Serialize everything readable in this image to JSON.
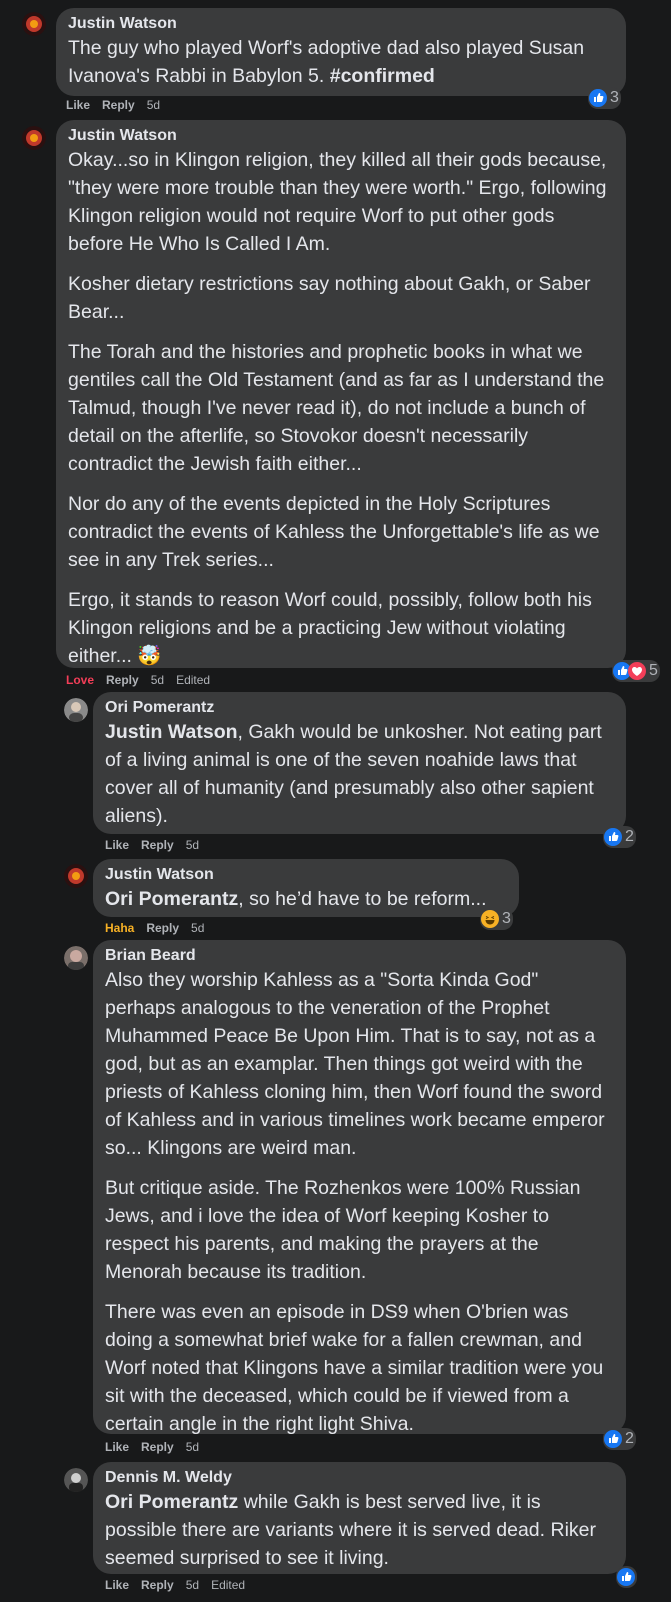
{
  "comments": [
    {
      "author": "Justin Watson",
      "paragraphs": [
        "The guy who played Worf's adoptive dad also played Susan Ivanova's Rabbi in Babylon 5. "
      ],
      "hashtag": "#confirmed",
      "actions": {
        "like": "Like",
        "reply": "Reply",
        "time": "5d"
      },
      "reactions": {
        "count": "3"
      }
    },
    {
      "author": "Justin Watson",
      "paragraphs": [
        "Okay...so in Klingon religion, they killed all their gods because, \"they were more trouble than they were worth.\" Ergo, following Klingon religion would not require Worf to put other gods before He Who Is Called I Am.",
        "Kosher dietary restrictions say nothing about Gakh, or Saber Bear...",
        "The Torah and the histories and prophetic books in what we gentiles call the Old Testament (and as far as I understand the Talmud, though I've never read it), do not include a bunch of detail on the afterlife, so Stovokor doesn't necessarily contradict the Jewish faith either...",
        "Nor do any of the events depicted in the Holy Scriptures contradict the events of Kahless the Unforgettable's life as we see in any Trek series...",
        "Ergo, it stands to reason Worf could, possibly, follow both his Klingon religions and be a practicing Jew without violating either... 🤯"
      ],
      "actions": {
        "like": "Love",
        "reply": "Reply",
        "time": "5d",
        "edited": "Edited"
      },
      "reactions": {
        "count": "5"
      }
    },
    {
      "author": "Ori Pomerantz",
      "mention": "Justin Watson",
      "paragraphs": [
        ", Gakh would be unkosher. Not eating part of a living animal is one of the seven noahide laws that cover all of humanity (and presumably also other sapient aliens)."
      ],
      "actions": {
        "like": "Like",
        "reply": "Reply",
        "time": "5d"
      },
      "reactions": {
        "count": "2"
      }
    },
    {
      "author": "Justin Watson",
      "mention": "Ori Pomerantz",
      "paragraphs": [
        ", so he’d have to be reform..."
      ],
      "actions": {
        "like": "Haha",
        "reply": "Reply",
        "time": "5d"
      },
      "reactions": {
        "count": "3"
      }
    },
    {
      "author": "Brian Beard",
      "paragraphs": [
        "Also they worship Kahless as a \"Sorta Kinda God\" perhaps analogous to the veneration of the Prophet Muhammed Peace Be Upon Him. That is to say, not as a god, but as an examplar. Then things got weird with the priests of Kahless cloning him, then Worf found the sword of Kahless and in various timelines work became emperor so... Klingons are weird man.",
        "But critique aside. The Rozhenkos were 100% Russian Jews, and i love the idea of Worf keeping Kosher to respect his parents, and making the prayers at the Menorah because its tradition.",
        "There was even an episode in DS9 when O'brien was doing a somewhat brief wake for a fallen crewman, and Worf noted that Klingons have a similar tradition were you sit with the deceased, which could be if viewed from a certain angle in the right light Shiva."
      ],
      "actions": {
        "like": "Like",
        "reply": "Reply",
        "time": "5d"
      },
      "reactions": {
        "count": "2"
      }
    },
    {
      "author": "Dennis M. Weldy",
      "mention": "Ori Pomerantz",
      "paragraphs": [
        " while Gakh is best served live, it is possible there are variants where it is served dead. Riker seemed surprised to see it living."
      ],
      "actions": {
        "like": "Like",
        "reply": "Reply",
        "time": "5d",
        "edited": "Edited"
      },
      "reactions": {
        "count": ""
      }
    }
  ],
  "colors": {
    "background": "#18191a",
    "bubble": "#3a3b3c",
    "like_blue": "#1877f2",
    "love_red": "#f33e58",
    "haha_yellow": "#f7b125"
  }
}
